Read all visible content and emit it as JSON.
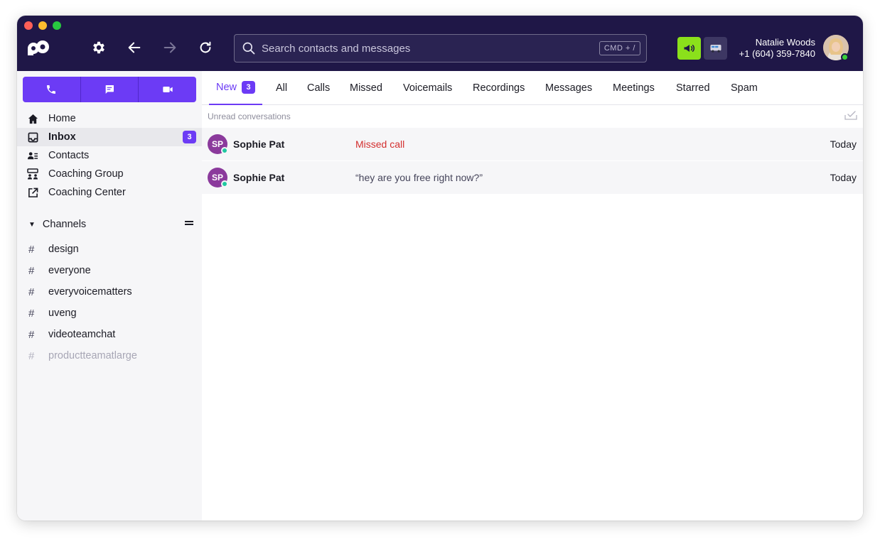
{
  "window": {
    "controls": [
      "close",
      "minimize",
      "zoom"
    ]
  },
  "topbar": {
    "logo_icon": "dialpad-logo-icon",
    "settings_icon": "gear-icon",
    "back_icon": "arrow-left-icon",
    "forward_icon": "arrow-right-icon",
    "refresh_icon": "refresh-icon",
    "search": {
      "placeholder": "Search contacts and messages",
      "value": "",
      "shortcut": "CMD + /"
    },
    "status_buttons": [
      {
        "icon": "megaphone-icon",
        "color": "#8be01b"
      },
      {
        "icon": "van-icon",
        "color": "#3d3763"
      }
    ],
    "user": {
      "name": "Natalie Woods",
      "phone": "+1 (604) 359-7840",
      "presence_color": "#3ad13a"
    }
  },
  "sidebar": {
    "actions": [
      {
        "icon": "phone-icon",
        "label": "call"
      },
      {
        "icon": "message-icon",
        "label": "message"
      },
      {
        "icon": "video-icon",
        "label": "video"
      }
    ],
    "nav": [
      {
        "icon": "home-icon",
        "label": "Home",
        "active": false
      },
      {
        "icon": "inbox-icon",
        "label": "Inbox",
        "active": true,
        "badge": "3"
      },
      {
        "icon": "contacts-icon",
        "label": "Contacts",
        "active": false
      },
      {
        "icon": "coaching-group-icon",
        "label": "Coaching Group",
        "active": false
      },
      {
        "icon": "external-link-icon",
        "label": "Coaching Center",
        "active": false
      }
    ],
    "channels": {
      "header": "Channels",
      "items": [
        {
          "name": "design",
          "muted": false
        },
        {
          "name": "everyone",
          "muted": false
        },
        {
          "name": "everyvoicematters",
          "muted": false
        },
        {
          "name": "uveng",
          "muted": false
        },
        {
          "name": "videoteamchat",
          "muted": false
        },
        {
          "name": "productteamatlarge",
          "muted": true
        }
      ]
    }
  },
  "main": {
    "tabs": [
      {
        "label": "New",
        "badge": "3",
        "active": true
      },
      {
        "label": "All"
      },
      {
        "label": "Calls"
      },
      {
        "label": "Missed"
      },
      {
        "label": "Voicemails"
      },
      {
        "label": "Recordings"
      },
      {
        "label": "Messages"
      },
      {
        "label": "Meetings"
      },
      {
        "label": "Starred"
      },
      {
        "label": "Spam"
      }
    ],
    "section_label": "Unread conversations",
    "mark_read_icon": "mark-all-read-icon",
    "conversations": [
      {
        "initials": "SP",
        "name": "Sophie Pat",
        "preview": "Missed call",
        "type": "missed",
        "time": "Today"
      },
      {
        "initials": "SP",
        "name": "Sophie Pat",
        "preview": "“hey are you free right now?”",
        "type": "message",
        "time": "Today"
      }
    ]
  },
  "colors": {
    "accent": "#6c3bf5",
    "topbar": "#1f1747",
    "missed": "#d32f2f",
    "contact_avatar": "#8b3a9c"
  }
}
